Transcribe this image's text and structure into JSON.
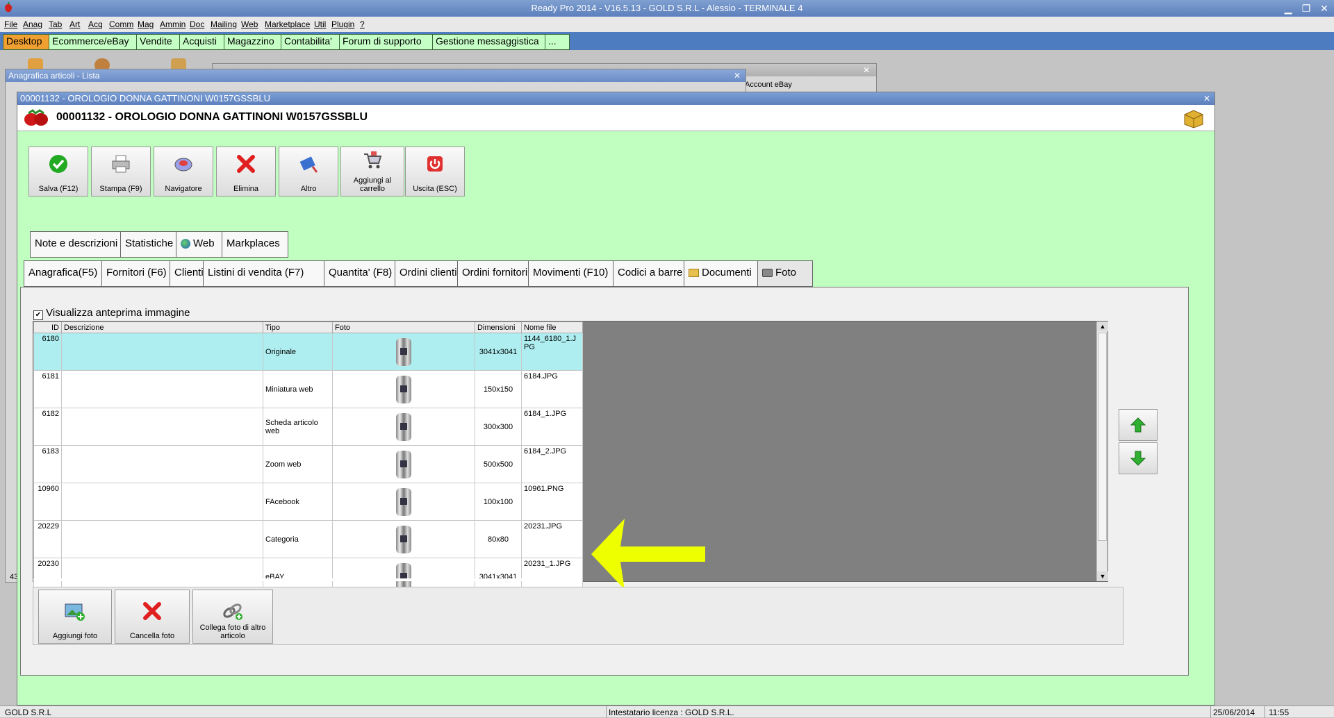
{
  "app": {
    "title": "Ready Pro 2014 - V16.5.13 - GOLD S.R.L - Alessio - TERMINALE 4"
  },
  "menu": [
    "File",
    "Anag",
    "Tab",
    "Art",
    "Acq",
    "Comm",
    "Mag",
    "Ammin",
    "Doc",
    "Mailing",
    "Web",
    "Marketplace",
    "Util",
    "Plugin",
    "?"
  ],
  "taskbar": [
    "Desktop",
    "Ecommerce/eBay",
    "Vendite",
    "Acquisti",
    "Magazzino",
    "Contabilita'",
    "Forum di supporto",
    "Gestione messaggistica",
    "..."
  ],
  "bg_windows": {
    "list_title": "Anagrafica articoli  - Lista",
    "ebay_label": "Account eBay",
    "status_num": "43"
  },
  "main": {
    "title": "00001132 - OROLOGIO DONNA GATTINONI W0157GSSBLU",
    "header_title": "00001132 - OROLOGIO DONNA GATTINONI W0157GSSBLU",
    "toolbar": {
      "save": "Salva (F12)",
      "print": "Stampa (F9)",
      "navigator": "Navigatore",
      "delete": "Elimina",
      "other": "Altro",
      "add_cart": "Aggiungi al carrello",
      "exit": "Uscita (ESC)"
    },
    "tabs_row1": [
      "Note e descrizioni",
      "Statistiche",
      "Web",
      "Markplaces"
    ],
    "tabs_row2": [
      "Anagrafica(F5)",
      "Fornitori (F6)",
      "Clienti",
      "Listini di vendita (F7)",
      "Quantita' (F8)",
      "Ordini clienti",
      "Ordini fornitori",
      "Movimenti (F10)",
      "Codici a barre",
      "Documenti",
      "Foto"
    ],
    "preview_checkbox": "Visualizza anteprima immagine",
    "grid": {
      "headers": [
        "ID",
        "Descrizione",
        "Tipo",
        "Foto",
        "Dimensioni",
        "Nome file"
      ],
      "rows": [
        {
          "id": "6180",
          "desc": "",
          "tipo": "Originale",
          "dim": "3041x3041",
          "file": "1144_6180_1.JPG"
        },
        {
          "id": "6181",
          "desc": "",
          "tipo": "Miniatura web",
          "dim": "150x150",
          "file": "6184.JPG"
        },
        {
          "id": "6182",
          "desc": "",
          "tipo": "Scheda articolo web",
          "dim": "300x300",
          "file": "6184_1.JPG"
        },
        {
          "id": "6183",
          "desc": "",
          "tipo": "Zoom web",
          "dim": "500x500",
          "file": "6184_2.JPG"
        },
        {
          "id": "10960",
          "desc": "",
          "tipo": "FAcebook",
          "dim": "100x100",
          "file": "10961.PNG"
        },
        {
          "id": "20229",
          "desc": "",
          "tipo": "Categoria",
          "dim": "80x80",
          "file": "20231.JPG"
        },
        {
          "id": "20230",
          "desc": "",
          "tipo": "eBAY",
          "dim": "3041x3041",
          "file": "20231_1.JPG"
        }
      ]
    },
    "bottom": {
      "add_photo": "Aggiungi foto",
      "delete_photo": "Cancella foto",
      "link_photo": "Collega foto di altro articolo"
    }
  },
  "status": {
    "company": "GOLD S.R.L",
    "license": "Intestatario licenza : GOLD S.R.L.",
    "date": "25/06/2014",
    "time": "11:55"
  },
  "colors": {
    "window_bg": "#c0ffc0",
    "selected_row": "#aeeef0",
    "active_task": "#f0a030",
    "arrow": "#eeff00"
  }
}
